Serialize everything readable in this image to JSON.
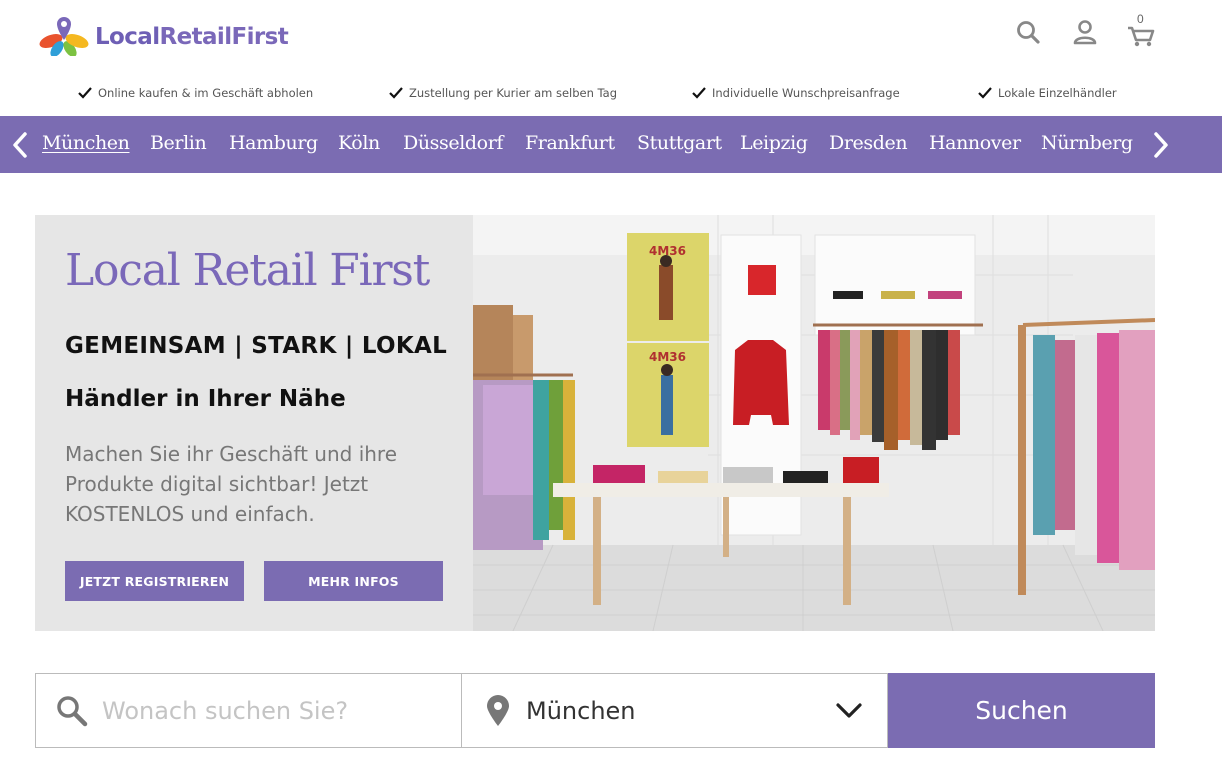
{
  "brand": {
    "name_part1": "Local",
    "name_part2": "RetailFirst",
    "primary_color": "#7b6cb2"
  },
  "header": {
    "icons": [
      "search-icon",
      "user-icon",
      "cart-icon"
    ],
    "cart_count": "0"
  },
  "usps": [
    "Online kaufen & im Geschäft abholen",
    "Zustellung per Kurier am selben Tag",
    "Individuelle Wunschpreisanfrage",
    "Lokale Einzelhändler"
  ],
  "cities": [
    "München",
    "Berlin",
    "Hamburg",
    "Köln",
    "Düsseldorf",
    "Frankfurt",
    "Stuttgart",
    "Leipzig",
    "Dresden",
    "Hannover",
    "Nürnberg"
  ],
  "active_city": "München",
  "hero": {
    "title": "Local Retail First",
    "tagline": "GEMEINSAM | STARK | LOKAL",
    "subtitle": "Händler in Ihrer Nähe",
    "description": "Machen Sie ihr Geschäft und ihre Produkte digital sichtbar! Jetzt KOSTENLOS und einfach.",
    "register_button": "JETZT REGISTRIEREN",
    "info_button": "MEHR INFOS",
    "poster_text_1": "4M36",
    "poster_text_2": "4M36"
  },
  "search": {
    "placeholder": "Wonach suchen Sie?",
    "location_value": "München",
    "submit_label": "Suchen"
  }
}
